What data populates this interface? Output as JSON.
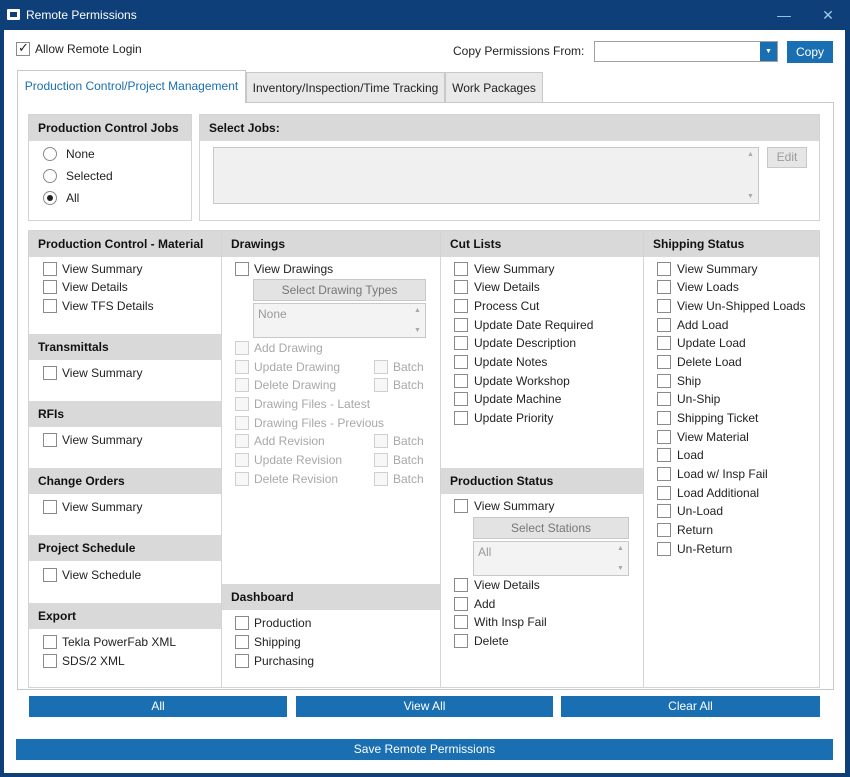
{
  "window": {
    "title": "Remote Permissions",
    "minimize_glyph": "—",
    "close_glyph": "✕"
  },
  "top": {
    "allow_remote_login": "Allow Remote Login",
    "copy_from_label": "Copy Permissions From:",
    "copy_from_value": "",
    "copy_button": "Copy"
  },
  "tabs": [
    "Production Control/Project Management",
    "Inventory/Inspection/Time Tracking",
    "Work Packages"
  ],
  "jobs": {
    "header": "Production Control Jobs",
    "options": [
      "None",
      "Selected",
      "All"
    ],
    "selected": "All",
    "select_jobs_header": "Select Jobs:",
    "edit_button": "Edit"
  },
  "material": {
    "header": "Production Control - Material",
    "items": [
      "View Summary",
      "View Details",
      "View TFS Details"
    ]
  },
  "transmittals": {
    "header": "Transmittals",
    "items": [
      "View Summary"
    ]
  },
  "rfis": {
    "header": "RFIs",
    "items": [
      "View Summary"
    ]
  },
  "change_orders": {
    "header": "Change Orders",
    "items": [
      "View Summary"
    ]
  },
  "project_schedule": {
    "header": "Project Schedule",
    "items": [
      "View Schedule"
    ]
  },
  "export": {
    "header": "Export",
    "items": [
      "Tekla PowerFab XML",
      "SDS/2 XML"
    ]
  },
  "drawings": {
    "header": "Drawings",
    "view": "View Drawings",
    "select_types_button": "Select Drawing Types",
    "types_value": "None",
    "items": [
      "Add Drawing",
      "Update Drawing",
      "Delete Drawing",
      "Drawing Files - Latest",
      "Drawing Files - Previous",
      "Add Revision",
      "Update Revision",
      "Delete Revision"
    ],
    "batch_label": "Batch"
  },
  "dashboard": {
    "header": "Dashboard",
    "items": [
      "Production",
      "Shipping",
      "Purchasing"
    ]
  },
  "cut_lists": {
    "header": "Cut Lists",
    "items": [
      "View Summary",
      "View Details",
      "Process Cut",
      "Update Date Required",
      "Update Description",
      "Update Notes",
      "Update Workshop",
      "Update Machine",
      "Update Priority"
    ]
  },
  "production_status": {
    "header": "Production Status",
    "view": "View Summary",
    "select_stations_button": "Select Stations",
    "stations_value": "All",
    "items": [
      "View Details",
      "Add",
      "With Insp Fail",
      "Delete"
    ]
  },
  "shipping": {
    "header": "Shipping Status",
    "items": [
      "View Summary",
      "View Loads",
      "View Un-Shipped Loads",
      "Add Load",
      "Update Load",
      "Delete Load",
      "Ship",
      "Un-Ship",
      "Shipping Ticket",
      "View Material",
      "Load",
      "Load w/ Insp Fail",
      "Load Additional",
      "Un-Load",
      "Return",
      "Un-Return"
    ]
  },
  "bottom": {
    "all": "All",
    "view_all": "View All",
    "clear_all": "Clear All",
    "save": "Save Remote Permissions"
  },
  "colors": {
    "titlebar": "#0f3f78",
    "accent": "#1a6fb3",
    "header_bg": "#d9d9d9"
  }
}
